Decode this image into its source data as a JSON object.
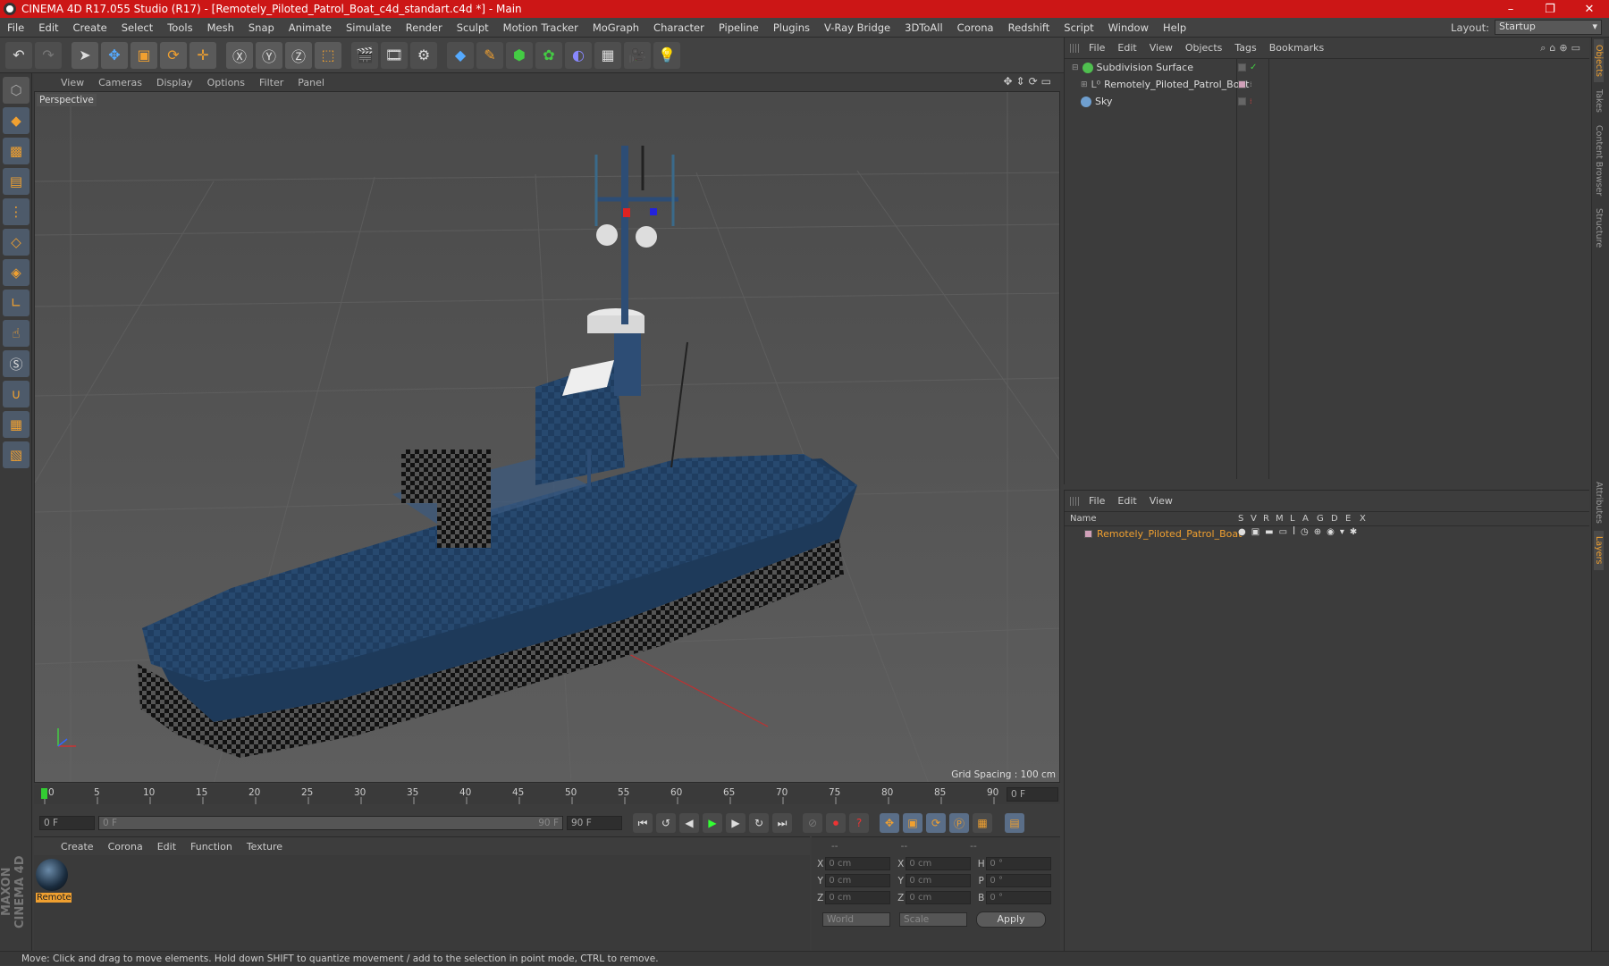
{
  "window": {
    "title": "CINEMA 4D R17.055 Studio (R17) - [Remotely_Piloted_Patrol_Boat_c4d_standart.c4d *] - Main",
    "minimize": "–",
    "maximize": "❐",
    "close": "✕"
  },
  "menu": [
    "File",
    "Edit",
    "Create",
    "Select",
    "Tools",
    "Mesh",
    "Snap",
    "Animate",
    "Simulate",
    "Render",
    "Sculpt",
    "Motion Tracker",
    "MoGraph",
    "Character",
    "Pipeline",
    "Plugins",
    "V-Ray Bridge",
    "3DToAll",
    "Corona",
    "Redshift",
    "Script",
    "Window",
    "Help"
  ],
  "layout": {
    "label": "Layout:",
    "value": "Startup"
  },
  "viewport": {
    "menu": [
      "View",
      "Cameras",
      "Display",
      "Options",
      "Filter",
      "Panel"
    ],
    "camera_label": "Perspective",
    "grid_spacing": "Grid Spacing : 100 cm"
  },
  "timeline": {
    "ticks": [
      "0",
      "5",
      "10",
      "15",
      "20",
      "25",
      "30",
      "35",
      "40",
      "45",
      "50",
      "55",
      "60",
      "65",
      "70",
      "75",
      "80",
      "85",
      "90"
    ],
    "end_field": "0 F",
    "current": "0 F",
    "range_start": "0 F",
    "range_end": "90 F",
    "max": "90 F"
  },
  "material_panel": {
    "menu": [
      "Create",
      "Corona",
      "Edit",
      "Function",
      "Texture"
    ],
    "material_name": "Remotel"
  },
  "coords": {
    "headers": [
      "--",
      "--",
      "--"
    ],
    "rows": [
      {
        "a": "X",
        "v1": "0 cm",
        "b": "X",
        "v2": "0 cm",
        "c": "H",
        "v3": "0 °"
      },
      {
        "a": "Y",
        "v1": "0 cm",
        "b": "Y",
        "v2": "0 cm",
        "c": "P",
        "v3": "0 °"
      },
      {
        "a": "Z",
        "v1": "0 cm",
        "b": "Z",
        "v2": "0 cm",
        "c": "B",
        "v3": "0 °"
      }
    ],
    "mode1": "World",
    "mode2": "Scale",
    "apply": "Apply"
  },
  "object_manager": {
    "menu": [
      "File",
      "Edit",
      "View",
      "Objects",
      "Tags",
      "Bookmarks"
    ],
    "objects": [
      {
        "name": "Subdivision Surface",
        "color": "#4fbf4f"
      },
      {
        "name": "Remotely_Piloted_Patrol_Boat",
        "color": "#aaaaaa"
      },
      {
        "name": "Sky",
        "color": "#6f9fcf"
      }
    ]
  },
  "layer_manager": {
    "menu": [
      "File",
      "Edit",
      "View"
    ],
    "columns": [
      "Name",
      "S",
      "V",
      "R",
      "M",
      "L",
      "A",
      "G",
      "D",
      "E",
      "X"
    ],
    "layers": [
      {
        "name": "Remotely_Piloted_Patrol_Boat",
        "color": "#d0a0b8"
      }
    ]
  },
  "right_tabs": [
    "Objects",
    "Takes",
    "Content Browser",
    "Structure",
    "Attributes",
    "Layers"
  ],
  "status": "Move: Click and drag to move elements. Hold down SHIFT to quantize movement / add to the selection in point mode, CTRL to remove.",
  "branding": "MAXON CINEMA 4D"
}
